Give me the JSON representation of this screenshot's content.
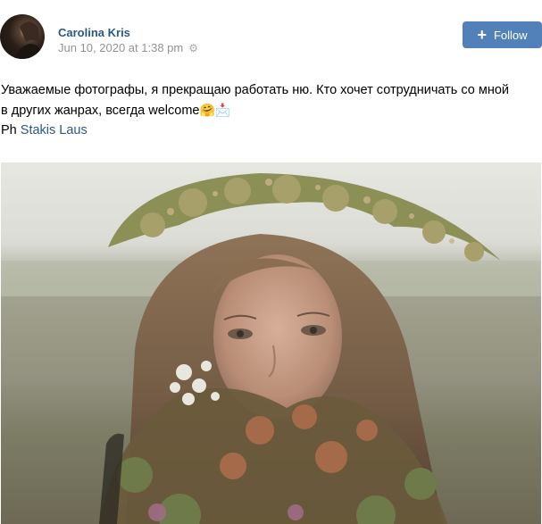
{
  "post": {
    "author_name": "Carolina Kris",
    "timestamp": "Jun 10, 2020 at 1:38 pm",
    "settings_icon": "gear-icon",
    "follow_label": "Follow",
    "follow_icon": "plus-icon",
    "text_line1": "Уважаемые фотографы, я прекращаю работать ню. Кто хочет сотрудничать со мной",
    "text_line2": "в других жанрах, всегда welcome",
    "emoji1": "🤗",
    "emoji2": "📩",
    "credit_prefix": "Ph",
    "credit_link": "Stakis Laus"
  },
  "colors": {
    "accent": "#5181b8",
    "link": "#2a5885",
    "muted": "#939393"
  }
}
